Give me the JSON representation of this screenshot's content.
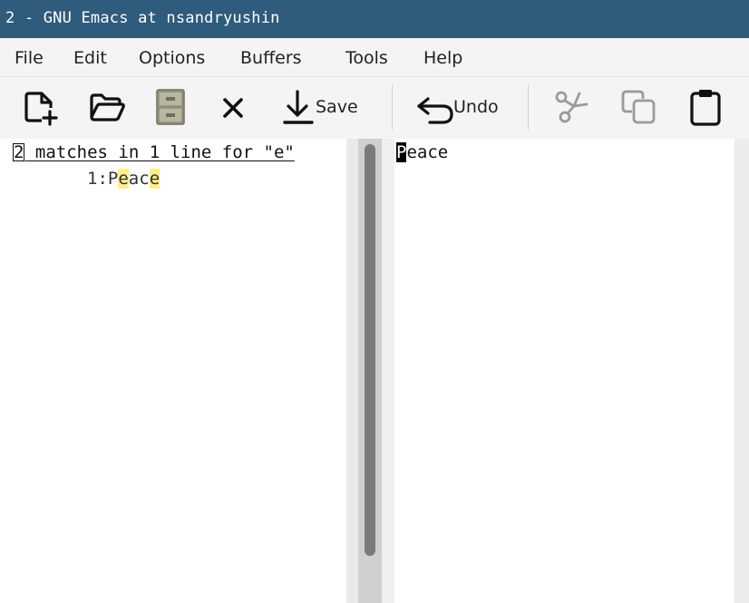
{
  "window": {
    "title": "2 - GNU Emacs at nsandryushin"
  },
  "menu": [
    "File",
    "Edit",
    "Options",
    "Buffers",
    "Tools",
    "Help"
  ],
  "toolbar": {
    "save_label": "Save",
    "undo_label": "Undo",
    "icons": [
      "new-file-icon",
      "open-folder-icon",
      "save-file-cabinet-icon",
      "close-x-icon",
      "save-download-icon",
      "undo-arrow-icon",
      "cut-scissors-icon",
      "copy-icon",
      "paste-clipboard-icon"
    ]
  },
  "occur": {
    "header_first_char": "2",
    "header_rest": " matches in 1 line for \"e\"",
    "truncation_arrow": "→",
    "line_number": "1:",
    "line_text": [
      "P",
      "e",
      "ac",
      "e"
    ]
  },
  "buffer": {
    "cursor_char": "P",
    "rest_text": "eace"
  },
  "colors": {
    "titlebar": "#2f5b7c",
    "match_highlight": "#ffef8a",
    "scroll_thumb": "#7a7a7a"
  }
}
